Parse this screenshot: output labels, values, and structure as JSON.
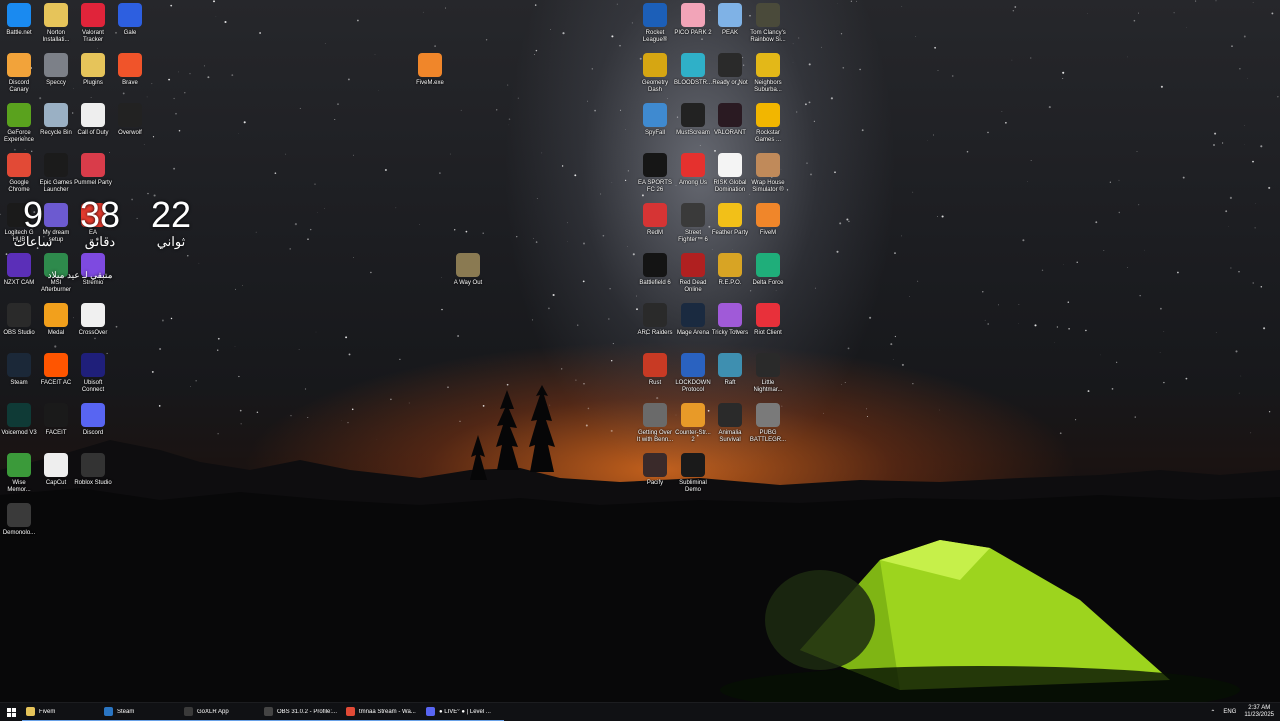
{
  "desktop_icons_left": [
    {
      "label": "Battle.net",
      "icon": "battlenet-icon",
      "color": "#1a8af0"
    },
    {
      "label": "Norton Installati...",
      "icon": "folder-icon",
      "color": "#e6c45a"
    },
    {
      "label": "Valorant Tracker",
      "icon": "valorant-tracker-icon",
      "color": "#e0243a"
    },
    {
      "label": "Gale",
      "icon": "gale-icon",
      "color": "#2d5fe0"
    },
    {
      "label": "Discord Canary",
      "icon": "discord-canary-icon",
      "color": "#f2a33a"
    },
    {
      "label": "Speccy",
      "icon": "speccy-icon",
      "color": "#7c8088"
    },
    {
      "label": "Plugins",
      "icon": "folder-icon",
      "color": "#e6c45a"
    },
    {
      "label": "Brave",
      "icon": "brave-icon",
      "color": "#f0542a"
    },
    {
      "label": "GeForce Experience",
      "icon": "geforce-icon",
      "color": "#5aa21e"
    },
    {
      "label": "Recycle Bin",
      "icon": "recycle-bin-icon",
      "color": "#9ab0c4"
    },
    {
      "label": "Call of Duty",
      "icon": "file-icon",
      "color": "#eeeeee"
    },
    {
      "label": "Overwolf",
      "icon": "overwolf-icon",
      "color": "#222222"
    },
    {
      "label": "Google Chrome",
      "icon": "chrome-icon",
      "color": "#e24a36"
    },
    {
      "label": "Epic Games Launcher",
      "icon": "epic-games-icon",
      "color": "#1b1b1b"
    },
    {
      "label": "Pummel Party",
      "icon": "pummel-party-icon",
      "color": "#d93c4a"
    },
    {
      "label": "",
      "icon": "blank",
      "color": ""
    },
    {
      "label": "Logitech G HUB",
      "icon": "logitech-icon",
      "color": "#1a1a1a"
    },
    {
      "label": "My dream setup",
      "icon": "dream-setup-icon",
      "color": "#6c5ad0"
    },
    {
      "label": "EA",
      "icon": "ea-icon",
      "color": "#e33a2e"
    },
    {
      "label": "",
      "icon": "blank",
      "color": ""
    },
    {
      "label": "NZXT CAM",
      "icon": "nzxt-icon",
      "color": "#5b2fb8"
    },
    {
      "label": "MSI Afterburner",
      "icon": "msi-afterburner-icon",
      "color": "#2e8a4c"
    },
    {
      "label": "Stremio",
      "icon": "stremio-icon",
      "color": "#7e4ae0"
    },
    {
      "label": "",
      "icon": "blank",
      "color": ""
    },
    {
      "label": "OBS Studio",
      "icon": "obs-icon",
      "color": "#2a2a2a"
    },
    {
      "label": "Medal",
      "icon": "medal-icon",
      "color": "#f2a01c"
    },
    {
      "label": "CrossOver",
      "icon": "crossover-icon",
      "color": "#f0f0f0"
    },
    {
      "label": "",
      "icon": "blank",
      "color": ""
    },
    {
      "label": "Steam",
      "icon": "steam-icon",
      "color": "#1b2838"
    },
    {
      "label": "FACEIT AC",
      "icon": "faceit-ac-icon",
      "color": "#ff5500"
    },
    {
      "label": "Ubisoft Connect",
      "icon": "ubisoft-icon",
      "color": "#1f1f7a"
    },
    {
      "label": "",
      "icon": "blank",
      "color": ""
    },
    {
      "label": "Voicemod V3",
      "icon": "voicemod-icon",
      "color": "#0f3a36"
    },
    {
      "label": "FACEIT",
      "icon": "faceit-icon",
      "color": "#1a1a1a"
    },
    {
      "label": "Discord",
      "icon": "discord-icon",
      "color": "#5865f2"
    },
    {
      "label": "",
      "icon": "blank",
      "color": ""
    },
    {
      "label": "Wise Memor...",
      "icon": "wise-memory-icon",
      "color": "#3b9a3a"
    },
    {
      "label": "CapCut",
      "icon": "file-icon",
      "color": "#eeeeee"
    },
    {
      "label": "Roblox Studio",
      "icon": "roblox-studio-icon",
      "color": "#333333"
    },
    {
      "label": "",
      "icon": "blank",
      "color": ""
    },
    {
      "label": "Demonolo...",
      "icon": "demonologist-icon",
      "color": "#3a3a3a"
    }
  ],
  "desktop_icons_mid": [
    {
      "label": "FiveM.exe",
      "icon": "fivem-icon",
      "color": "#f0862a"
    },
    {
      "label": "A Way Out",
      "icon": "a-way-out-icon",
      "color": "#8a7a52"
    }
  ],
  "desktop_icons_right": [
    {
      "label": "Rocket League®",
      "icon": "rocket-league-icon",
      "color": "#1c5fb8"
    },
    {
      "label": "PICO PARK 2",
      "icon": "pico-park-icon",
      "color": "#f2a4b8"
    },
    {
      "label": "PEAK",
      "icon": "peak-icon",
      "color": "#7fb2e6"
    },
    {
      "label": "Tom Clancy's Rainbow Si...",
      "icon": "rainbow-six-icon",
      "color": "#4a4a3a"
    },
    {
      "label": "Geometry Dash",
      "icon": "geometry-dash-icon",
      "color": "#d6a612"
    },
    {
      "label": "BLOODSTR...",
      "icon": "bloodstrike-icon",
      "color": "#2fb0c8"
    },
    {
      "label": "Ready or Not",
      "icon": "ready-or-not-icon",
      "color": "#2a2a2a"
    },
    {
      "label": "Neighbors Suburba...",
      "icon": "neighbors-icon",
      "color": "#e3b818"
    },
    {
      "label": "SpyFall",
      "icon": "spyfall-icon",
      "color": "#3f8ad0"
    },
    {
      "label": "MustScream",
      "icon": "mustscream-icon",
      "color": "#222222"
    },
    {
      "label": "VALORANT",
      "icon": "valorant-icon",
      "color": "#2a1a22"
    },
    {
      "label": "Rockstar Games ...",
      "icon": "rockstar-icon",
      "color": "#f2b600"
    },
    {
      "label": "EA SPORTS FC 26",
      "icon": "ea-fc-icon",
      "color": "#161616"
    },
    {
      "label": "Among Us",
      "icon": "among-us-icon",
      "color": "#e5312e"
    },
    {
      "label": "RISK Global Domination",
      "icon": "risk-icon",
      "color": "#f4f4f4"
    },
    {
      "label": "Wrap House Simulator ®",
      "icon": "wrap-house-icon",
      "color": "#c08a5a"
    },
    {
      "label": "RedM",
      "icon": "redm-icon",
      "color": "#d63434"
    },
    {
      "label": "Street Fighter™ 6",
      "icon": "street-fighter-icon",
      "color": "#3a3a3a"
    },
    {
      "label": "Feather Party",
      "icon": "feather-party-icon",
      "color": "#f2c018"
    },
    {
      "label": "FiveM",
      "icon": "fivem-icon",
      "color": "#f0862a"
    },
    {
      "label": "Battlefield 6",
      "icon": "battlefield-icon",
      "color": "#141414"
    },
    {
      "label": "Red Dead Online",
      "icon": "red-dead-online-icon",
      "color": "#b02020"
    },
    {
      "label": "R.E.P.O.",
      "icon": "repo-icon",
      "color": "#d8a424"
    },
    {
      "label": "Delta Force",
      "icon": "delta-force-icon",
      "color": "#1fae7a"
    },
    {
      "label": "ARC Raiders",
      "icon": "arc-raiders-icon",
      "color": "#2a2a2a"
    },
    {
      "label": "Mage Arena",
      "icon": "mage-arena-icon",
      "color": "#1a2a40"
    },
    {
      "label": "Tricky Towers",
      "icon": "tricky-towers-icon",
      "color": "#a05ad8"
    },
    {
      "label": "Riot Client",
      "icon": "riot-client-icon",
      "color": "#e8303a"
    },
    {
      "label": "Rust",
      "icon": "rust-icon",
      "color": "#c83a24"
    },
    {
      "label": "LOCKDOWN Protocol",
      "icon": "lockdown-protocol-icon",
      "color": "#2a62c0"
    },
    {
      "label": "Raft",
      "icon": "raft-icon",
      "color": "#3e8fb0"
    },
    {
      "label": "Little Nightmar...",
      "icon": "little-nightmares-icon",
      "color": "#2a2a2a"
    },
    {
      "label": "Getting Over It with Benn...",
      "icon": "getting-over-it-icon",
      "color": "#6a6a6a"
    },
    {
      "label": "Counter-Str... 2",
      "icon": "counter-strike-icon",
      "color": "#e89a28"
    },
    {
      "label": "Animalia Survival",
      "icon": "animalia-icon",
      "color": "#2a2a2a"
    },
    {
      "label": "PUBG BATTLEGR...",
      "icon": "pubg-icon",
      "color": "#7a7a7a"
    },
    {
      "label": "Pacify",
      "icon": "pacify-icon",
      "color": "#3a2a2a"
    },
    {
      "label": "Subliminal Demo",
      "icon": "subliminal-icon",
      "color": "#1a1a1a"
    }
  ],
  "clock_widget": {
    "hours": "9",
    "hours_label": "ساعات",
    "minutes": "38",
    "minutes_label": "دقائق",
    "seconds": "22",
    "seconds_label": "ثواني",
    "caption": "متبقي لـ عيد ميلاد"
  },
  "taskbar": {
    "items": [
      {
        "label": "Fivem",
        "icon": "folder-icon",
        "color": "#e6c45a"
      },
      {
        "label": "Steam",
        "icon": "steam-icon",
        "color": "#2a75c2"
      },
      {
        "label": "GoXLR App",
        "icon": "goxlr-icon",
        "color": "#3a3a3a"
      },
      {
        "label": "OBS 31.0.2 - Profile:...",
        "icon": "obs-icon",
        "color": "#444444"
      },
      {
        "label": "tmnaa Stream - Wa...",
        "icon": "chrome-icon",
        "color": "#e24a36"
      },
      {
        "label": "● LIVE° ● | Level ...",
        "icon": "discord-icon",
        "color": "#5865f2"
      }
    ],
    "tray": {
      "language": "ENG",
      "time": "2:37 AM",
      "date": "11/23/2025"
    }
  }
}
